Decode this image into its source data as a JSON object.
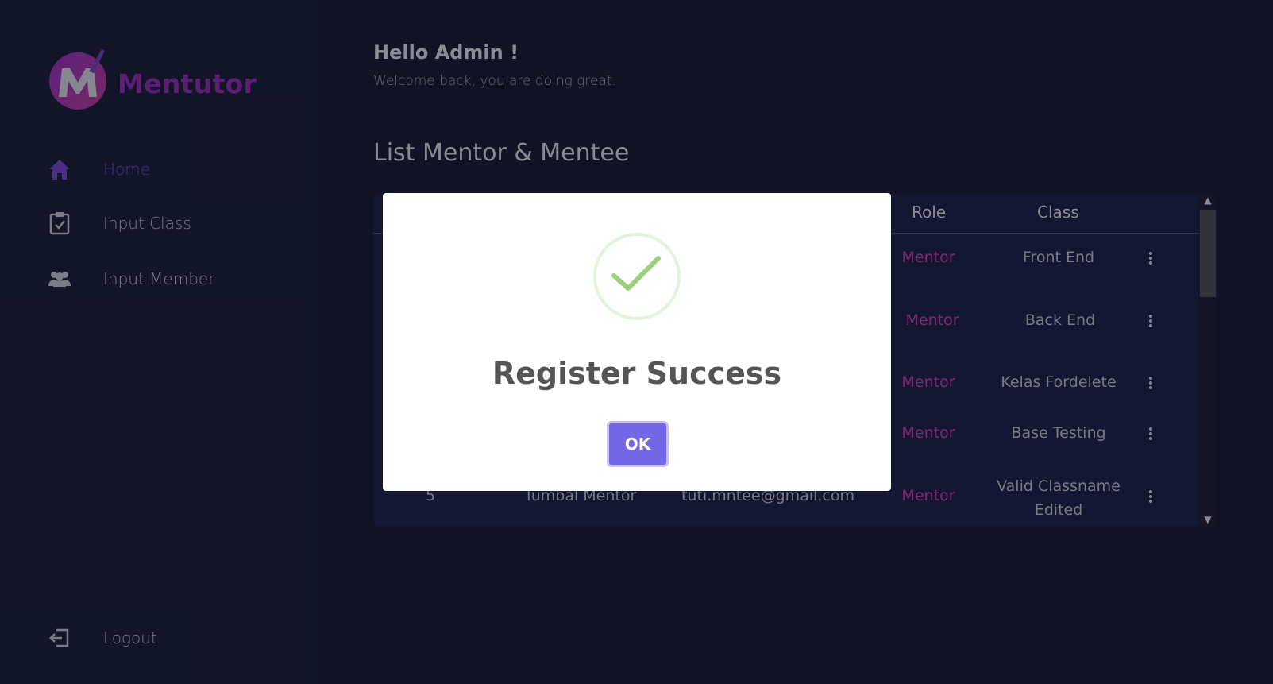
{
  "app": {
    "brand": "Mentutor"
  },
  "sidebar": {
    "items": [
      {
        "label": "Home",
        "icon": "home-icon",
        "active": true
      },
      {
        "label": "Input Class",
        "icon": "clipboard-check-icon",
        "active": false
      },
      {
        "label": "Input Member",
        "icon": "users-icon",
        "active": false
      }
    ],
    "logout_label": "Logout",
    "logout_icon": "logout-icon"
  },
  "header": {
    "greeting": "Hello Admin !",
    "subtitle": "Welcome back, you are doing great."
  },
  "list": {
    "title": "List Mentor & Mentee",
    "columns": {
      "role": "Role",
      "class": "Class"
    },
    "rows": [
      {
        "role": "Mentor",
        "class": "Front End"
      },
      {
        "role": "Mentor",
        "class": "Back End"
      },
      {
        "role": "Mentor",
        "class": "Kelas Fordelete"
      },
      {
        "role": "Mentor",
        "class": "Base Testing"
      },
      {
        "no": "5",
        "name": "Tumbal Mentor",
        "email": "tuti.mntee@gmail.com",
        "role": "Mentor",
        "class_line1": "Valid Classname",
        "class_line2": "Edited"
      }
    ]
  },
  "modal": {
    "title": "Register Success",
    "ok_label": "OK",
    "icon": "success-check-icon"
  },
  "colors": {
    "accent": "#7467e6",
    "brand": "#8a2aa8",
    "role": "#c03a9c",
    "active_nav": "#6e44c2",
    "background": "#181a33"
  }
}
